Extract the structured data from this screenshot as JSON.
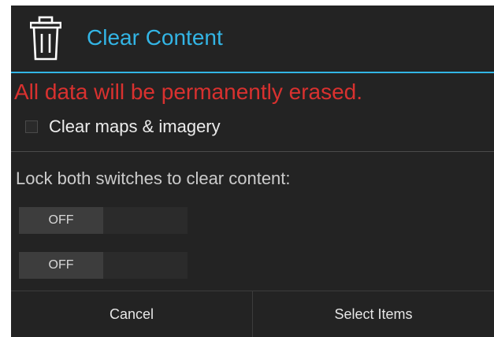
{
  "dialog": {
    "title": "Clear Content",
    "title_icon": "trash-icon",
    "warning": "All data will be permanently erased.",
    "checkbox": {
      "label": "Clear maps & imagery",
      "checked": false
    },
    "instruction": "Lock both switches to clear content:",
    "switches": [
      {
        "state_label": "OFF",
        "on": false
      },
      {
        "state_label": "OFF",
        "on": false
      }
    ],
    "buttons": {
      "cancel_label": "Cancel",
      "confirm_label": "Select Items"
    }
  },
  "colors": {
    "accent": "#33b5e5",
    "warning": "#d9312f",
    "background": "#232323"
  }
}
